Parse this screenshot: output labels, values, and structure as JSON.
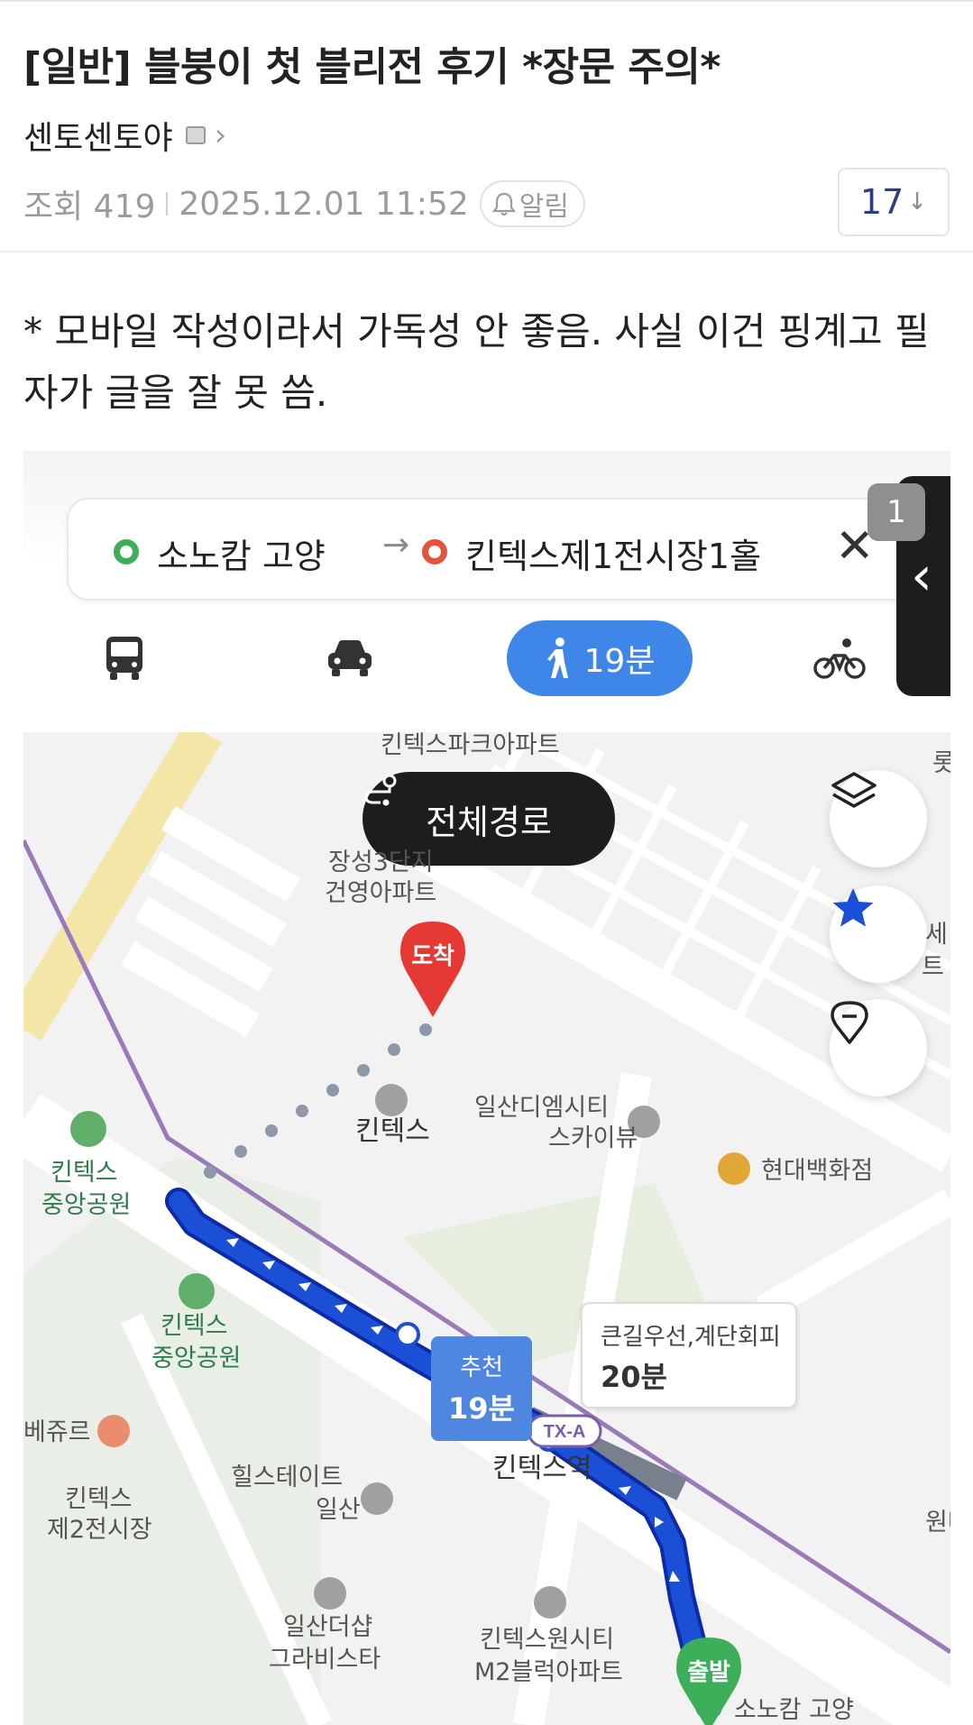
{
  "post": {
    "title": "[일반] 블붕이 첫 블리전 후기 *장문 주의*",
    "author": "센토센토야",
    "views_label": "조회 419",
    "datetime": "2025.12.01 11:52",
    "alert_label": "알림",
    "comment_count": "17",
    "body": "* 모바일 작성이라서 가독성 안 좋음. 사실 이건 핑계고 필자가 글을 잘 못 씀."
  },
  "map_shot": {
    "route": {
      "from": "소노캄 고양",
      "to": "킨텍스제1전시장1홀"
    },
    "side_tab_number": "1",
    "walk_time": "19분",
    "full_route_button": "전체경로",
    "arrive_marker": "도착",
    "depart_marker": "출발",
    "recommended": {
      "label": "추천",
      "time": "19분"
    },
    "alternative": {
      "label": "큰길우선,계단회피",
      "time": "20분"
    },
    "station_badge": "TX-A",
    "labels": {
      "kintex_park_apt": "킨텍스파크아파트",
      "jangseong_1": "장성3단지",
      "jangseong_2": "건영아파트",
      "kintex": "킨텍스",
      "dmcity_1": "일산디엠시티",
      "dmcity_2": "스카이뷰",
      "hyundai": "현대백화점",
      "park_a_1": "킨텍스",
      "park_a_2": "중앙공원",
      "park_b_1": "킨텍스",
      "park_b_2": "중앙공원",
      "kintex_station": "킨텍스역",
      "hillstate_1": "힐스테이트",
      "hillstate_2": "일산",
      "kintex_hall2_1": "킨텍스",
      "kintex_hall2_2": "제2전시장",
      "mall_left": "베쥬르",
      "gravista_1": "일산더샵",
      "gravista_2": "그라비스타",
      "onecity_1": "킨텍스원시티",
      "onecity_2": "M2블럭아파트",
      "sonocalm": "소노캄 고양",
      "edge_right_1": "세",
      "edge_right_2": "트",
      "edge_top_right": "롯",
      "edge_bottom_right": "원마"
    }
  },
  "colors": {
    "route_blue": "#1a4fd6",
    "walk_pill": "#3e87e9",
    "arrive_red": "#e53935",
    "depart_green": "#3fae5a",
    "comment_count": "#2f3b86"
  }
}
